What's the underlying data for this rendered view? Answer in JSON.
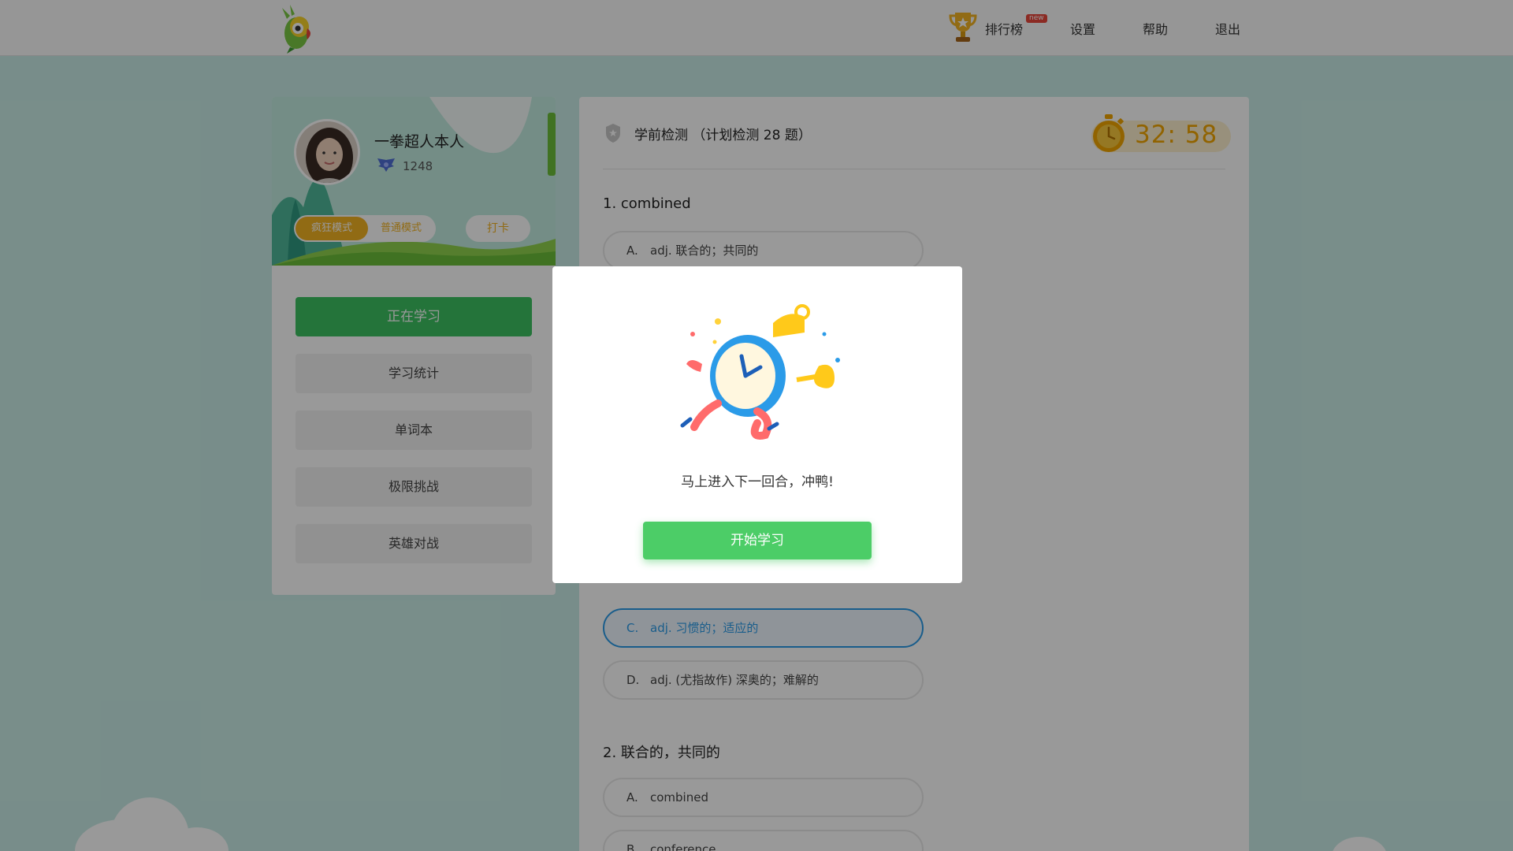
{
  "nav": {
    "rank_label": "排行榜",
    "new_badge": "new",
    "settings_label": "设置",
    "help_label": "帮助",
    "logout_label": "退出"
  },
  "profile": {
    "username": "一拳超人本人",
    "score": "1248",
    "mode_crazy": "疯狂模式",
    "mode_normal": "普通模式",
    "checkin": "打卡"
  },
  "menu": {
    "items": [
      {
        "label": "正在学习",
        "active": true
      },
      {
        "label": "学习统计",
        "active": false
      },
      {
        "label": "单词本",
        "active": false
      },
      {
        "label": "极限挑战",
        "active": false
      },
      {
        "label": "英雄对战",
        "active": false
      }
    ]
  },
  "quiz": {
    "title": "学前检测 （计划检测 28 题）",
    "timer": "32: 58",
    "q1": {
      "text": "1. combined",
      "options": [
        {
          "letter": "A.",
          "text": "adj. 联合的；共同的"
        },
        {
          "letter": "C.",
          "text": "adj. 习惯的；适应的"
        },
        {
          "letter": "D.",
          "text": "adj. (尤指故作) 深奥的；难解的"
        }
      ]
    },
    "q2": {
      "text": "2. 联合的，共同的",
      "options": [
        {
          "letter": "A.",
          "text": "combined"
        },
        {
          "letter": "B.",
          "text": "conference"
        }
      ]
    }
  },
  "modal": {
    "message": "马上进入下一回合，冲鸭!",
    "button": "开始学习"
  },
  "colors": {
    "primary_green": "#3cc261",
    "accent_orange": "#f2b222",
    "selected_blue": "#2b9be8",
    "background": "#c9ece6"
  },
  "icons": [
    "parrot-logo-icon",
    "trophy-icon",
    "score-wings-icon",
    "shield-icon",
    "stopwatch-icon",
    "alarm-clock-illustration"
  ]
}
